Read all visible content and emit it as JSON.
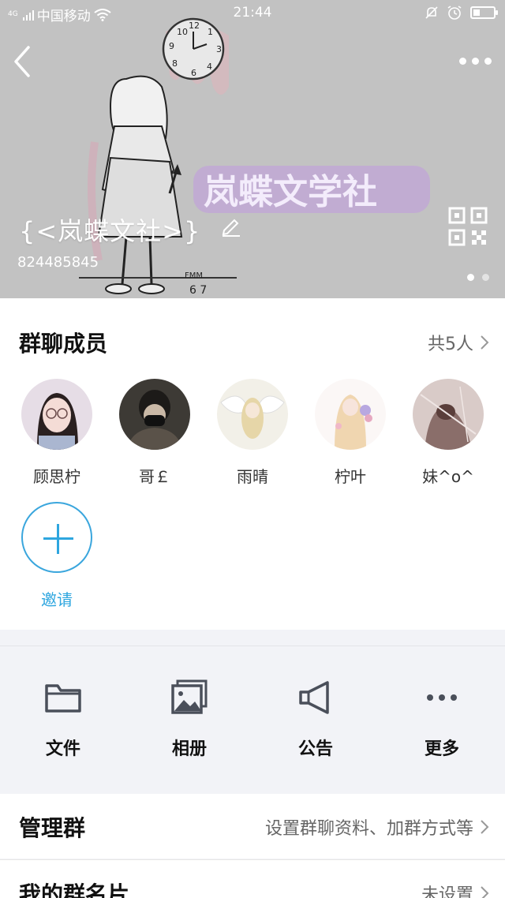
{
  "status_bar": {
    "signal": "4G",
    "carrier": "中国移动",
    "time": "21:44"
  },
  "header": {
    "group_name": "{<岚蝶文社>}",
    "group_id": "824485845",
    "banner_text": "岚蝶文学社",
    "page_indicator": {
      "total": 2,
      "active": 1
    }
  },
  "members": {
    "title": "群聊成员",
    "count": "共5人",
    "list": [
      {
        "nickname": "顾思柠",
        "avatar": "girl-with-glasses"
      },
      {
        "nickname": "哥￡",
        "avatar": "boy-with-mask"
      },
      {
        "nickname": "雨晴",
        "avatar": "angel-wings"
      },
      {
        "nickname": "柠叶",
        "avatar": "flower-girl"
      },
      {
        "nickname": "妹^o^",
        "avatar": "sketch-girl"
      }
    ],
    "invite_label": "邀请"
  },
  "tools": [
    {
      "label": "文件",
      "icon": "folder-icon"
    },
    {
      "label": "相册",
      "icon": "album-icon"
    },
    {
      "label": "公告",
      "icon": "megaphone-icon"
    },
    {
      "label": "更多",
      "icon": "more-icon"
    }
  ],
  "settings": {
    "manage": {
      "title": "管理群",
      "value": "设置群聊资料、加群方式等"
    },
    "my_card": {
      "title": "我的群名片",
      "value": "未设置"
    }
  },
  "colors": {
    "accent": "#2ea6df",
    "banner_bg": "#bfbfbf",
    "page_bg": "#f2f3f7",
    "banner_text": "#b07ad6"
  }
}
